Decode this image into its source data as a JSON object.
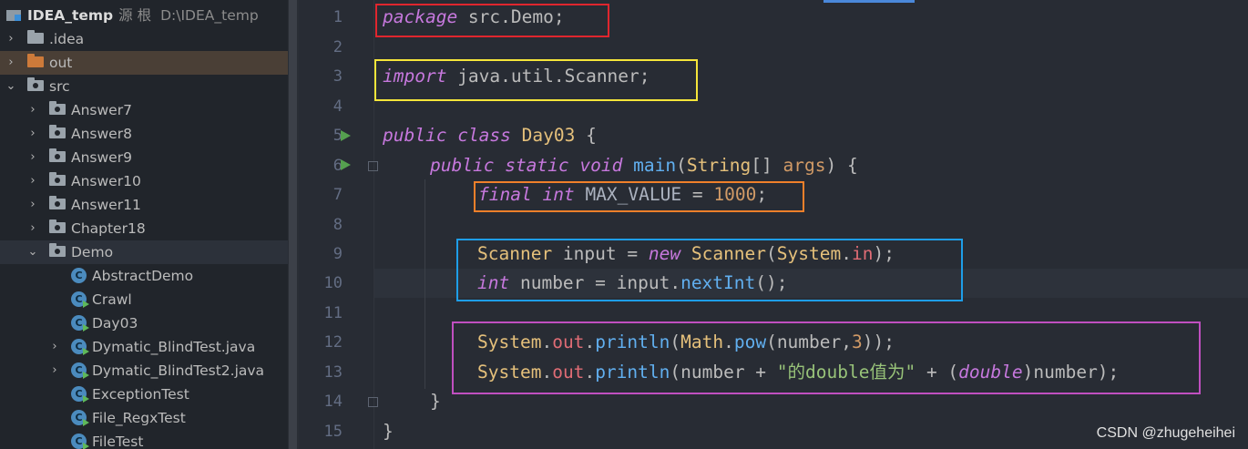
{
  "project": {
    "root": {
      "name": "IDEA_temp",
      "extra": "源 根",
      "path": "D:\\IDEA_temp"
    },
    "items": [
      {
        "label": ".idea"
      },
      {
        "label": "out"
      },
      {
        "label": "src"
      },
      {
        "label": "Answer7"
      },
      {
        "label": "Answer8"
      },
      {
        "label": "Answer9"
      },
      {
        "label": "Answer10"
      },
      {
        "label": "Answer11"
      },
      {
        "label": "Chapter18"
      },
      {
        "label": "Demo"
      },
      {
        "label": "AbstractDemo"
      },
      {
        "label": "Crawl"
      },
      {
        "label": "Day03"
      },
      {
        "label": "Dymatic_BlindTest.java"
      },
      {
        "label": "Dymatic_BlindTest2.java"
      },
      {
        "label": "ExceptionTest"
      },
      {
        "label": "File_RegxTest"
      },
      {
        "label": "FileTest"
      }
    ]
  },
  "editor": {
    "line_numbers": [
      "1",
      "2",
      "3",
      "4",
      "5",
      "6",
      "7",
      "8",
      "9",
      "10",
      "11",
      "12",
      "13",
      "14",
      "15"
    ],
    "code": {
      "l1": {
        "kw": "package",
        "rest": " src.Demo;"
      },
      "l3": {
        "kw": "import",
        "rest": " java.util.Scanner;"
      },
      "l5": {
        "kw1": "public",
        "kw2": "class",
        "cls": "Day03",
        "rest": " {"
      },
      "l6": {
        "kw1": "public",
        "kw2": "static",
        "kw3": "void",
        "fn": "main",
        "p1": "(",
        "ty": "String",
        "p2": "[] ",
        "arg": "args",
        "p3": ") {"
      },
      "l7": {
        "kw1": "final",
        "kw2": "int",
        "cn": "MAX_VALUE",
        "eq": " = ",
        "num": "1000",
        "end": ";"
      },
      "l9": {
        "ty1": "Scanner",
        "v": " input = ",
        "kw": "new",
        "ty2": "Scanner",
        "p1": "(",
        "ty3": "System",
        "dot": ".",
        "fd": "in",
        "p2": ");"
      },
      "l10": {
        "kw": "int",
        "v": " number = input.",
        "fn": "nextInt",
        "p": "();"
      },
      "l12": {
        "ty1": "System",
        "d1": ".",
        "fd": "out",
        "d2": ".",
        "fn1": "println",
        "p1": "(",
        "ty2": "Math",
        "d3": ".",
        "fn2": "pow",
        "p2": "(number,",
        "num": "3",
        "p3": "));"
      },
      "l13": {
        "ty1": "System",
        "d1": ".",
        "fd": "out",
        "d2": ".",
        "fn1": "println",
        "p1": "(number + ",
        "str": "\"的double值为\"",
        "p2": " + (",
        "kw": "double",
        "p3": ")number);"
      },
      "l14": {
        "t": "}"
      },
      "l15": {
        "t": "}"
      }
    },
    "box_colors": {
      "package": "#e0262e",
      "import": "#f5e53a",
      "final": "#f0802a",
      "scanner": "#1e9ee8",
      "println": "#c04fc0"
    }
  },
  "watermark": "CSDN @zhugeheihei"
}
